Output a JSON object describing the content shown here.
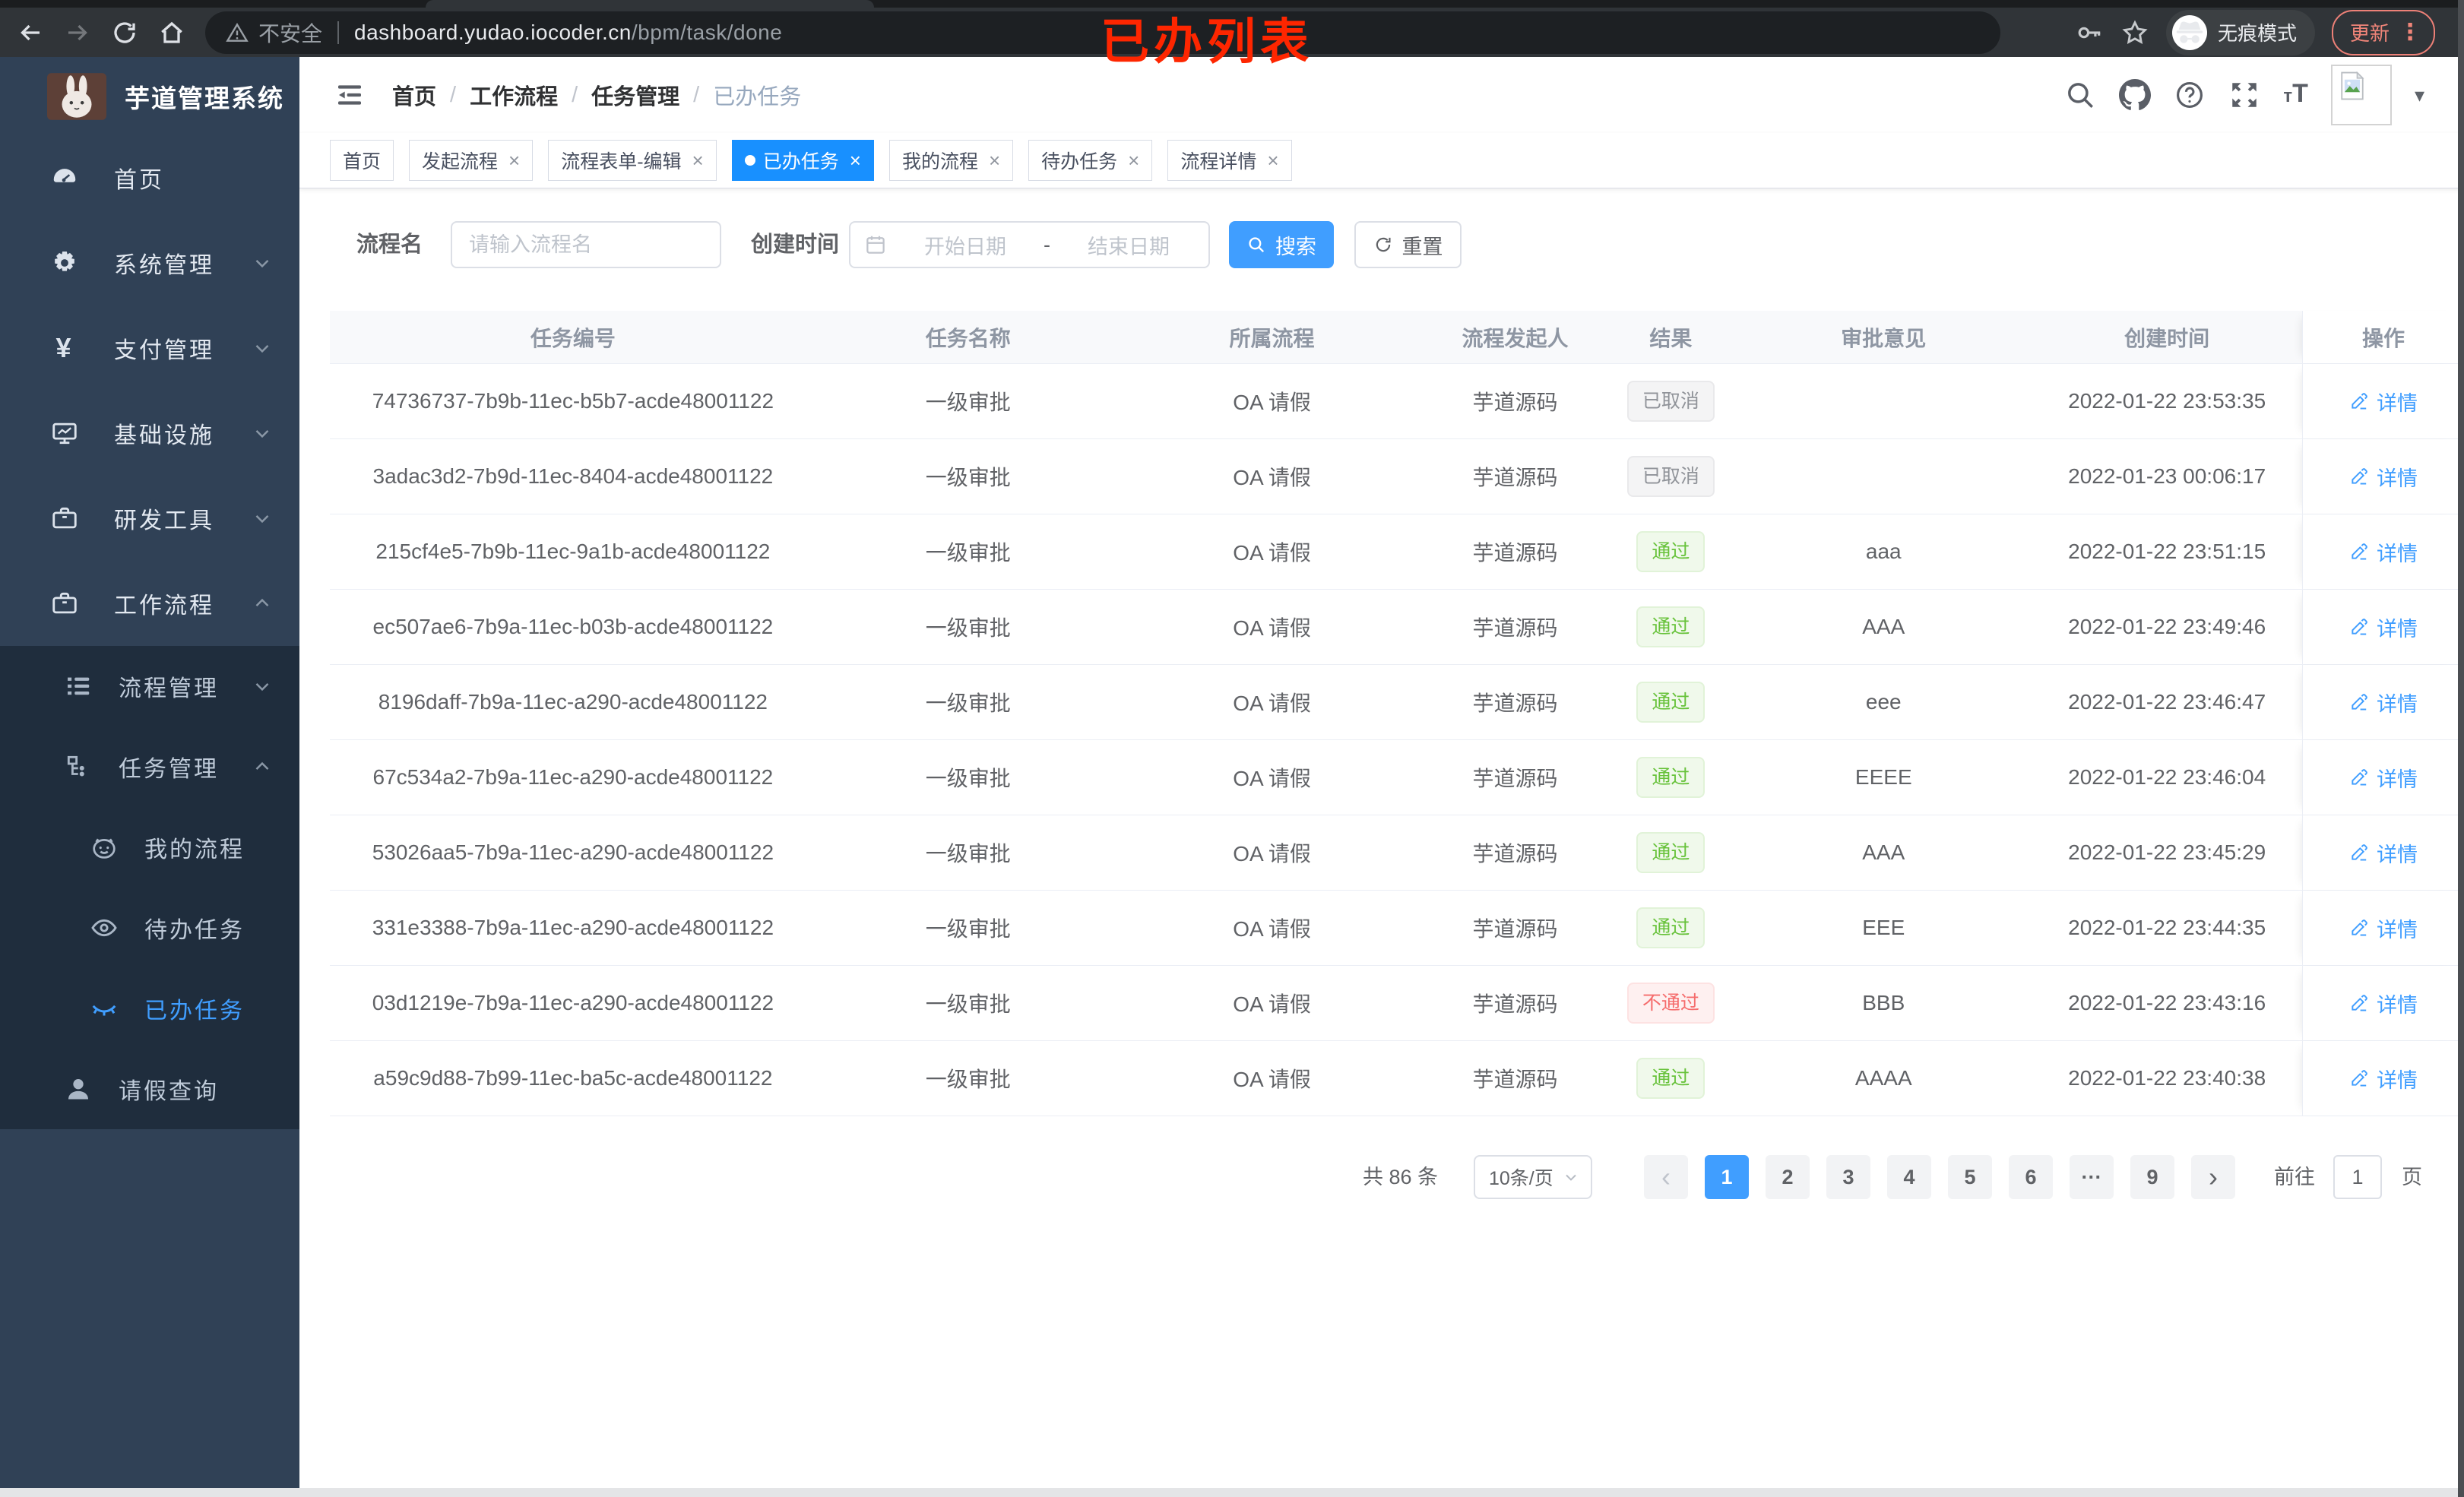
{
  "browser": {
    "security_label": "不安全",
    "url_host": "dashboard.yudao.iocoder.cn",
    "url_path": "/bpm/task/done",
    "incognito_label": "无痕模式",
    "update_label": "更新"
  },
  "overlay_title": "已办列表",
  "sidebar": {
    "app_title": "芋道管理系统",
    "menu": [
      {
        "key": "home",
        "icon": "dashboard-icon",
        "label": "首页",
        "level": 1
      },
      {
        "key": "system",
        "icon": "gear-icon",
        "label": "系统管理",
        "level": 1,
        "chevron": "down"
      },
      {
        "key": "payment",
        "icon": "yen-icon",
        "label": "支付管理",
        "level": 1,
        "chevron": "down"
      },
      {
        "key": "infra",
        "icon": "infrastructure-icon",
        "label": "基础设施",
        "level": 1,
        "chevron": "down"
      },
      {
        "key": "devtools",
        "icon": "toolbox-icon",
        "label": "研发工具",
        "level": 1,
        "chevron": "down"
      },
      {
        "key": "workflow",
        "icon": "briefcase-icon",
        "label": "工作流程",
        "level": 1,
        "chevron": "up"
      },
      {
        "key": "process-mgmt",
        "icon": "process-list-icon",
        "label": "流程管理",
        "level": 2,
        "chevron": "down",
        "submenu": true
      },
      {
        "key": "task-mgmt",
        "icon": "task-tree-icon",
        "label": "任务管理",
        "level": 2,
        "chevron": "up",
        "submenu": true
      },
      {
        "key": "my-process",
        "icon": "face-icon",
        "label": "我的流程",
        "level": 3,
        "submenu": true
      },
      {
        "key": "todo-tasks",
        "icon": "eye-icon",
        "label": "待办任务",
        "level": 3,
        "submenu": true
      },
      {
        "key": "done-tasks",
        "icon": "closed-eye-icon",
        "label": "已办任务",
        "level": 3,
        "submenu": true,
        "active": true
      },
      {
        "key": "leave-query",
        "icon": "person-icon",
        "label": "请假查询",
        "level": 2,
        "submenu": true
      }
    ]
  },
  "navbar": {
    "breadcrumb": [
      "首页",
      "工作流程",
      "任务管理",
      "已办任务"
    ]
  },
  "tabs": [
    {
      "label": "首页",
      "closable": false,
      "active": false
    },
    {
      "label": "发起流程",
      "closable": true,
      "active": false
    },
    {
      "label": "流程表单-编辑",
      "closable": true,
      "active": false
    },
    {
      "label": "已办任务",
      "closable": true,
      "active": true
    },
    {
      "label": "我的流程",
      "closable": true,
      "active": false
    },
    {
      "label": "待办任务",
      "closable": true,
      "active": false
    },
    {
      "label": "流程详情",
      "closable": true,
      "active": false
    }
  ],
  "filters": {
    "name_label": "流程名",
    "name_placeholder": "请输入流程名",
    "name_value": "",
    "date_label": "创建时间",
    "date_start_placeholder": "开始日期",
    "date_separator": "-",
    "date_end_placeholder": "结束日期",
    "search_label": "搜索",
    "reset_label": "重置"
  },
  "table": {
    "columns": [
      "任务编号",
      "任务名称",
      "所属流程",
      "流程发起人",
      "结果",
      "审批意见",
      "创建时间",
      "操作"
    ],
    "action_label": "详情",
    "rows": [
      {
        "id": "74736737-7b9b-11ec-b5b7-acde48001122",
        "name": "一级审批",
        "process": "OA 请假",
        "starter": "芋道源码",
        "result": "已取消",
        "result_type": "info",
        "comment": "",
        "created": "2022-01-22 23:53:35"
      },
      {
        "id": "3adac3d2-7b9d-11ec-8404-acde48001122",
        "name": "一级审批",
        "process": "OA 请假",
        "starter": "芋道源码",
        "result": "已取消",
        "result_type": "info",
        "comment": "",
        "created": "2022-01-23 00:06:17"
      },
      {
        "id": "215cf4e5-7b9b-11ec-9a1b-acde48001122",
        "name": "一级审批",
        "process": "OA 请假",
        "starter": "芋道源码",
        "result": "通过",
        "result_type": "success",
        "comment": "aaa",
        "created": "2022-01-22 23:51:15"
      },
      {
        "id": "ec507ae6-7b9a-11ec-b03b-acde48001122",
        "name": "一级审批",
        "process": "OA 请假",
        "starter": "芋道源码",
        "result": "通过",
        "result_type": "success",
        "comment": "AAA",
        "created": "2022-01-22 23:49:46"
      },
      {
        "id": "8196daff-7b9a-11ec-a290-acde48001122",
        "name": "一级审批",
        "process": "OA 请假",
        "starter": "芋道源码",
        "result": "通过",
        "result_type": "success",
        "comment": "eee",
        "created": "2022-01-22 23:46:47"
      },
      {
        "id": "67c534a2-7b9a-11ec-a290-acde48001122",
        "name": "一级审批",
        "process": "OA 请假",
        "starter": "芋道源码",
        "result": "通过",
        "result_type": "success",
        "comment": "EEEE",
        "created": "2022-01-22 23:46:04"
      },
      {
        "id": "53026aa5-7b9a-11ec-a290-acde48001122",
        "name": "一级审批",
        "process": "OA 请假",
        "starter": "芋道源码",
        "result": "通过",
        "result_type": "success",
        "comment": "AAA",
        "created": "2022-01-22 23:45:29"
      },
      {
        "id": "331e3388-7b9a-11ec-a290-acde48001122",
        "name": "一级审批",
        "process": "OA 请假",
        "starter": "芋道源码",
        "result": "通过",
        "result_type": "success",
        "comment": "EEE",
        "created": "2022-01-22 23:44:35"
      },
      {
        "id": "03d1219e-7b9a-11ec-a290-acde48001122",
        "name": "一级审批",
        "process": "OA 请假",
        "starter": "芋道源码",
        "result": "不通过",
        "result_type": "danger",
        "comment": "BBB",
        "created": "2022-01-22 23:43:16"
      },
      {
        "id": "a59c9d88-7b99-11ec-ba5c-acde48001122",
        "name": "一级审批",
        "process": "OA 请假",
        "starter": "芋道源码",
        "result": "通过",
        "result_type": "success",
        "comment": "AAAA",
        "created": "2022-01-22 23:40:38"
      }
    ]
  },
  "pagination": {
    "total_label": "共 86 条",
    "page_size_label": "10条/页",
    "prev_label": "‹",
    "next_label": "›",
    "pages": [
      "1",
      "2",
      "3",
      "4",
      "5",
      "6",
      "···",
      "9"
    ],
    "active_page": "1",
    "goto_label": "前往",
    "goto_value": "1",
    "unit_label": "页"
  },
  "colors": {
    "accent": "#409eff",
    "tab_active": "#1890ff",
    "success": "#67c23a",
    "danger": "#f56c6c",
    "info": "#909399",
    "sidebar_bg": "#304156",
    "submenu_bg": "#1f2d3d",
    "annotation_red": "#fe2600"
  }
}
